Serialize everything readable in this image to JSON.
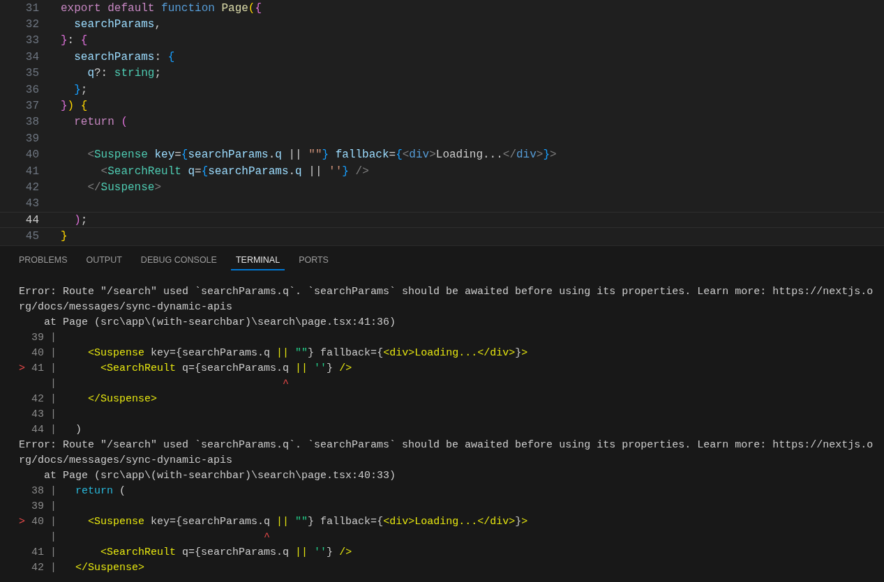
{
  "editor": {
    "lines": [
      {
        "number": "31",
        "current": false,
        "tokens": [
          {
            "text": "export ",
            "kind": "kw"
          },
          {
            "text": "default ",
            "kind": "kw"
          },
          {
            "text": "function ",
            "kind": "fn"
          },
          {
            "text": "Page",
            "kind": "name"
          },
          {
            "text": "(",
            "kind": "b1"
          },
          {
            "text": "{",
            "kind": "b2"
          }
        ]
      },
      {
        "number": "32",
        "current": false,
        "tokens": [
          {
            "text": "  searchParams",
            "kind": "var"
          },
          {
            "text": ",",
            "kind": "p"
          }
        ]
      },
      {
        "number": "33",
        "current": false,
        "tokens": [
          {
            "text": "}",
            "kind": "b2"
          },
          {
            "text": ": ",
            "kind": "p"
          },
          {
            "text": "{",
            "kind": "b2"
          }
        ]
      },
      {
        "number": "34",
        "current": false,
        "tokens": [
          {
            "text": "  searchParams",
            "kind": "var"
          },
          {
            "text": ": ",
            "kind": "p"
          },
          {
            "text": "{",
            "kind": "b3"
          }
        ]
      },
      {
        "number": "35",
        "current": false,
        "tokens": [
          {
            "text": "    q",
            "kind": "var"
          },
          {
            "text": "?: ",
            "kind": "p"
          },
          {
            "text": "string",
            "kind": "type"
          },
          {
            "text": ";",
            "kind": "p"
          }
        ]
      },
      {
        "number": "36",
        "current": false,
        "tokens": [
          {
            "text": "  }",
            "kind": "b3"
          },
          {
            "text": ";",
            "kind": "p"
          }
        ]
      },
      {
        "number": "37",
        "current": false,
        "tokens": [
          {
            "text": "}",
            "kind": "b2"
          },
          {
            "text": ")",
            "kind": "b1"
          },
          {
            "text": " {",
            "kind": "b1"
          }
        ]
      },
      {
        "number": "38",
        "current": false,
        "tokens": [
          {
            "text": "  return ",
            "kind": "kw"
          },
          {
            "text": "(",
            "kind": "b2"
          }
        ]
      },
      {
        "number": "39",
        "current": false
      },
      {
        "number": "40",
        "current": false,
        "tokens": [
          {
            "text": "    <",
            "kind": "tag"
          },
          {
            "text": "Suspense",
            "kind": "comp"
          },
          {
            "text": " key",
            "kind": "var"
          },
          {
            "text": "=",
            "kind": "p"
          },
          {
            "text": "{",
            "kind": "b3"
          },
          {
            "text": "searchParams",
            "kind": "var"
          },
          {
            "text": ".",
            "kind": "p"
          },
          {
            "text": "q",
            "kind": "var"
          },
          {
            "text": " || ",
            "kind": "p"
          },
          {
            "text": "\"\"",
            "kind": "str"
          },
          {
            "text": "}",
            "kind": "b3"
          },
          {
            "text": " fallback",
            "kind": "var"
          },
          {
            "text": "=",
            "kind": "p"
          },
          {
            "text": "{",
            "kind": "b3"
          },
          {
            "text": "<",
            "kind": "tag"
          },
          {
            "text": "div",
            "kind": "html"
          },
          {
            "text": ">",
            "kind": "tag"
          },
          {
            "text": "Loading...",
            "kind": "p"
          },
          {
            "text": "</",
            "kind": "tag"
          },
          {
            "text": "div",
            "kind": "html"
          },
          {
            "text": ">",
            "kind": "tag"
          },
          {
            "text": "}",
            "kind": "b3"
          },
          {
            "text": ">",
            "kind": "tag"
          }
        ]
      },
      {
        "number": "41",
        "current": false,
        "tokens": [
          {
            "text": "      <",
            "kind": "tag"
          },
          {
            "text": "SearchReult",
            "kind": "comp"
          },
          {
            "text": " q",
            "kind": "var"
          },
          {
            "text": "=",
            "kind": "p"
          },
          {
            "text": "{",
            "kind": "b3"
          },
          {
            "text": "searchParams",
            "kind": "var"
          },
          {
            "text": ".",
            "kind": "p"
          },
          {
            "text": "q",
            "kind": "var"
          },
          {
            "text": " || ",
            "kind": "p"
          },
          {
            "text": "''",
            "kind": "str"
          },
          {
            "text": "}",
            "kind": "b3"
          },
          {
            "text": " />",
            "kind": "tag"
          }
        ]
      },
      {
        "number": "42",
        "current": false,
        "tokens": [
          {
            "text": "    </",
            "kind": "tag"
          },
          {
            "text": "Suspense",
            "kind": "comp"
          },
          {
            "text": ">",
            "kind": "tag"
          }
        ]
      },
      {
        "number": "43",
        "current": false
      },
      {
        "number": "44",
        "current": true,
        "tokens": [
          {
            "text": "  )",
            "kind": "b2"
          },
          {
            "text": ";",
            "kind": "p"
          }
        ]
      },
      {
        "number": "45",
        "current": false,
        "tokens": [
          {
            "text": "}",
            "kind": "b1"
          }
        ]
      }
    ]
  },
  "panel": {
    "tabs": [
      {
        "label": "PROBLEMS",
        "selected": false
      },
      {
        "label": "OUTPUT",
        "selected": false
      },
      {
        "label": "DEBUG CONSOLE",
        "selected": false
      },
      {
        "label": "TERMINAL",
        "selected": true
      },
      {
        "label": "PORTS",
        "selected": false
      }
    ]
  },
  "terminal": {
    "lines": [
      {
        "kind": "text",
        "text": "Error: Route \"/search\" used `searchParams.q`. `searchParams` should be awaited before using its properties. Learn more: https://nextjs.o"
      },
      {
        "kind": "text",
        "text": "rg/docs/messages/sync-dynamic-apis"
      },
      {
        "kind": "text",
        "text": "    at Page (src\\app\\(with-searchbar)\\search\\page.tsx:41:36)"
      },
      {
        "kind": "frame",
        "number": "39",
        "bar": "|"
      },
      {
        "kind": "frame",
        "number": "40",
        "bar": "|",
        "tokens": [
          {
            "text": "    <Suspense",
            "kind": "y"
          },
          {
            "text": " key={searchParams.q ",
            "kind": "p"
          },
          {
            "text": "||",
            "kind": "y"
          },
          {
            "text": " \"\"",
            "kind": "g"
          },
          {
            "text": "} fallback={",
            "kind": "p"
          },
          {
            "text": "<div>Loading...</div>",
            "kind": "y"
          },
          {
            "text": "}",
            "kind": "p"
          },
          {
            "text": ">",
            "kind": "y"
          }
        ]
      },
      {
        "kind": "frame",
        "marker": ">",
        "number": "41",
        "bar": "|",
        "tokens": [
          {
            "text": "      <SearchReult",
            "kind": "y"
          },
          {
            "text": " q={searchParams.q ",
            "kind": "p"
          },
          {
            "text": "||",
            "kind": "y"
          },
          {
            "text": " ''",
            "kind": "g"
          },
          {
            "text": "} ",
            "kind": "p"
          },
          {
            "text": "/>",
            "kind": "y"
          }
        ]
      },
      {
        "kind": "frame",
        "bar": "|",
        "tokens": [
          {
            "text": "                                   ^",
            "kind": "r"
          }
        ]
      },
      {
        "kind": "frame",
        "number": "42",
        "bar": "|",
        "tokens": [
          {
            "text": "    </Suspense>",
            "kind": "y"
          }
        ]
      },
      {
        "kind": "frame",
        "number": "43",
        "bar": "|"
      },
      {
        "kind": "frame",
        "number": "44",
        "bar": "|",
        "tokens": [
          {
            "text": "  )",
            "kind": "p"
          }
        ]
      },
      {
        "kind": "text",
        "text": "Error: Route \"/search\" used `searchParams.q`. `searchParams` should be awaited before using its properties. Learn more: https://nextjs.o"
      },
      {
        "kind": "text",
        "text": "rg/docs/messages/sync-dynamic-apis"
      },
      {
        "kind": "text",
        "text": "    at Page (src\\app\\(with-searchbar)\\search\\page.tsx:40:33)"
      },
      {
        "kind": "frame",
        "number": "38",
        "bar": "|",
        "tokens": [
          {
            "text": "  return",
            "kind": "c"
          },
          {
            "text": " (",
            "kind": "p"
          }
        ]
      },
      {
        "kind": "frame",
        "number": "39",
        "bar": "|"
      },
      {
        "kind": "frame",
        "marker": ">",
        "number": "40",
        "bar": "|",
        "tokens": [
          {
            "text": "    <Suspense",
            "kind": "y"
          },
          {
            "text": " key={searchParams.q ",
            "kind": "p"
          },
          {
            "text": "||",
            "kind": "y"
          },
          {
            "text": " \"\"",
            "kind": "g"
          },
          {
            "text": "} fallback={",
            "kind": "p"
          },
          {
            "text": "<div>Loading...</div>",
            "kind": "y"
          },
          {
            "text": "}",
            "kind": "p"
          },
          {
            "text": ">",
            "kind": "y"
          }
        ]
      },
      {
        "kind": "frame",
        "bar": "|",
        "tokens": [
          {
            "text": "                                ^",
            "kind": "r"
          }
        ]
      },
      {
        "kind": "frame",
        "number": "41",
        "bar": "|",
        "tokens": [
          {
            "text": "      <SearchReult",
            "kind": "y"
          },
          {
            "text": " q={searchParams.q ",
            "kind": "p"
          },
          {
            "text": "||",
            "kind": "y"
          },
          {
            "text": " ''",
            "kind": "g"
          },
          {
            "text": "} ",
            "kind": "p"
          },
          {
            "text": "/>",
            "kind": "y"
          }
        ]
      },
      {
        "kind": "frame",
        "number": "42",
        "bar": "|",
        "tokens": [
          {
            "text": "  </Suspense>",
            "kind": "y"
          }
        ]
      }
    ]
  }
}
